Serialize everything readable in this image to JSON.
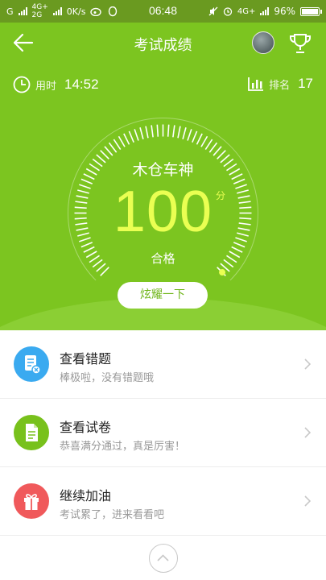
{
  "statusbar": {
    "carrier1": "G",
    "net1": "4G+",
    "net2": "2G",
    "speed": "0K/s",
    "time": "06:48",
    "net3": "4G+",
    "battery": "96%"
  },
  "header": {
    "title": "考试成绩"
  },
  "stats": {
    "time_label": "用时",
    "time_value": "14:52",
    "rank_label": "排名",
    "rank_value": "17"
  },
  "result": {
    "title": "木仓车神",
    "score": "100",
    "unit": "分",
    "verdict": "合格",
    "progress": 1.0,
    "share_label": "炫耀一下"
  },
  "menu": [
    {
      "title": "查看错题",
      "subtitle": "棒极啦，没有错题哦",
      "icon": "wrong-questions-icon",
      "color": "#3aaaf0"
    },
    {
      "title": "查看试卷",
      "subtitle": "恭喜满分通过，真是厉害！",
      "icon": "exam-paper-icon",
      "color": "#78c11c"
    },
    {
      "title": "继续加油",
      "subtitle": "考试累了，进来看看吧",
      "icon": "gift-icon",
      "color": "#f0595b"
    }
  ],
  "colors": {
    "primary_green": "#7cc520",
    "score_yellow": "#eaff52"
  }
}
